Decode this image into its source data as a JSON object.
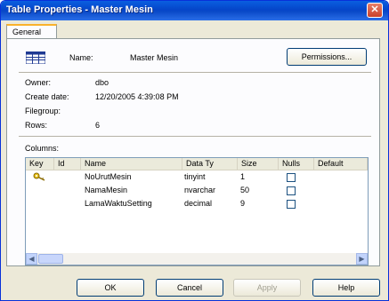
{
  "window": {
    "title": "Table Properties - Master Mesin",
    "close_label": "✕"
  },
  "tabs": [
    {
      "label": "General"
    }
  ],
  "general": {
    "name_label": "Name:",
    "name_value": "Master Mesin",
    "permissions_label": "Permissions...",
    "owner_label": "Owner:",
    "owner_value": "dbo",
    "create_date_label": "Create date:",
    "create_date_value": "12/20/2005 4:39:08 PM",
    "filegroup_label": "Filegroup:",
    "filegroup_value": "",
    "rows_label": "Rows:",
    "rows_value": "6",
    "columns_label": "Columns:"
  },
  "columns_table": {
    "headers": [
      "Key",
      "Id",
      "Name",
      "Data Ty",
      "Size",
      "Nulls",
      "Default"
    ],
    "rows": [
      {
        "key": "key-icon",
        "id": "",
        "name": "NoUrutMesin",
        "data_type": "tinyint",
        "size": "1",
        "nulls": false,
        "default": ""
      },
      {
        "key": "",
        "id": "",
        "name": "NamaMesin",
        "data_type": "nvarchar",
        "size": "50",
        "nulls": false,
        "default": ""
      },
      {
        "key": "",
        "id": "",
        "name": "LamaWaktuSetting",
        "data_type": "decimal",
        "size": "9",
        "nulls": false,
        "default": ""
      }
    ]
  },
  "buttons": {
    "ok": "OK",
    "cancel": "Cancel",
    "apply": "Apply",
    "help": "Help"
  },
  "colors": {
    "titlebar": "#0a4ac8",
    "dialog_bg": "#ece9d8",
    "key_icon": "#e8c21a"
  }
}
